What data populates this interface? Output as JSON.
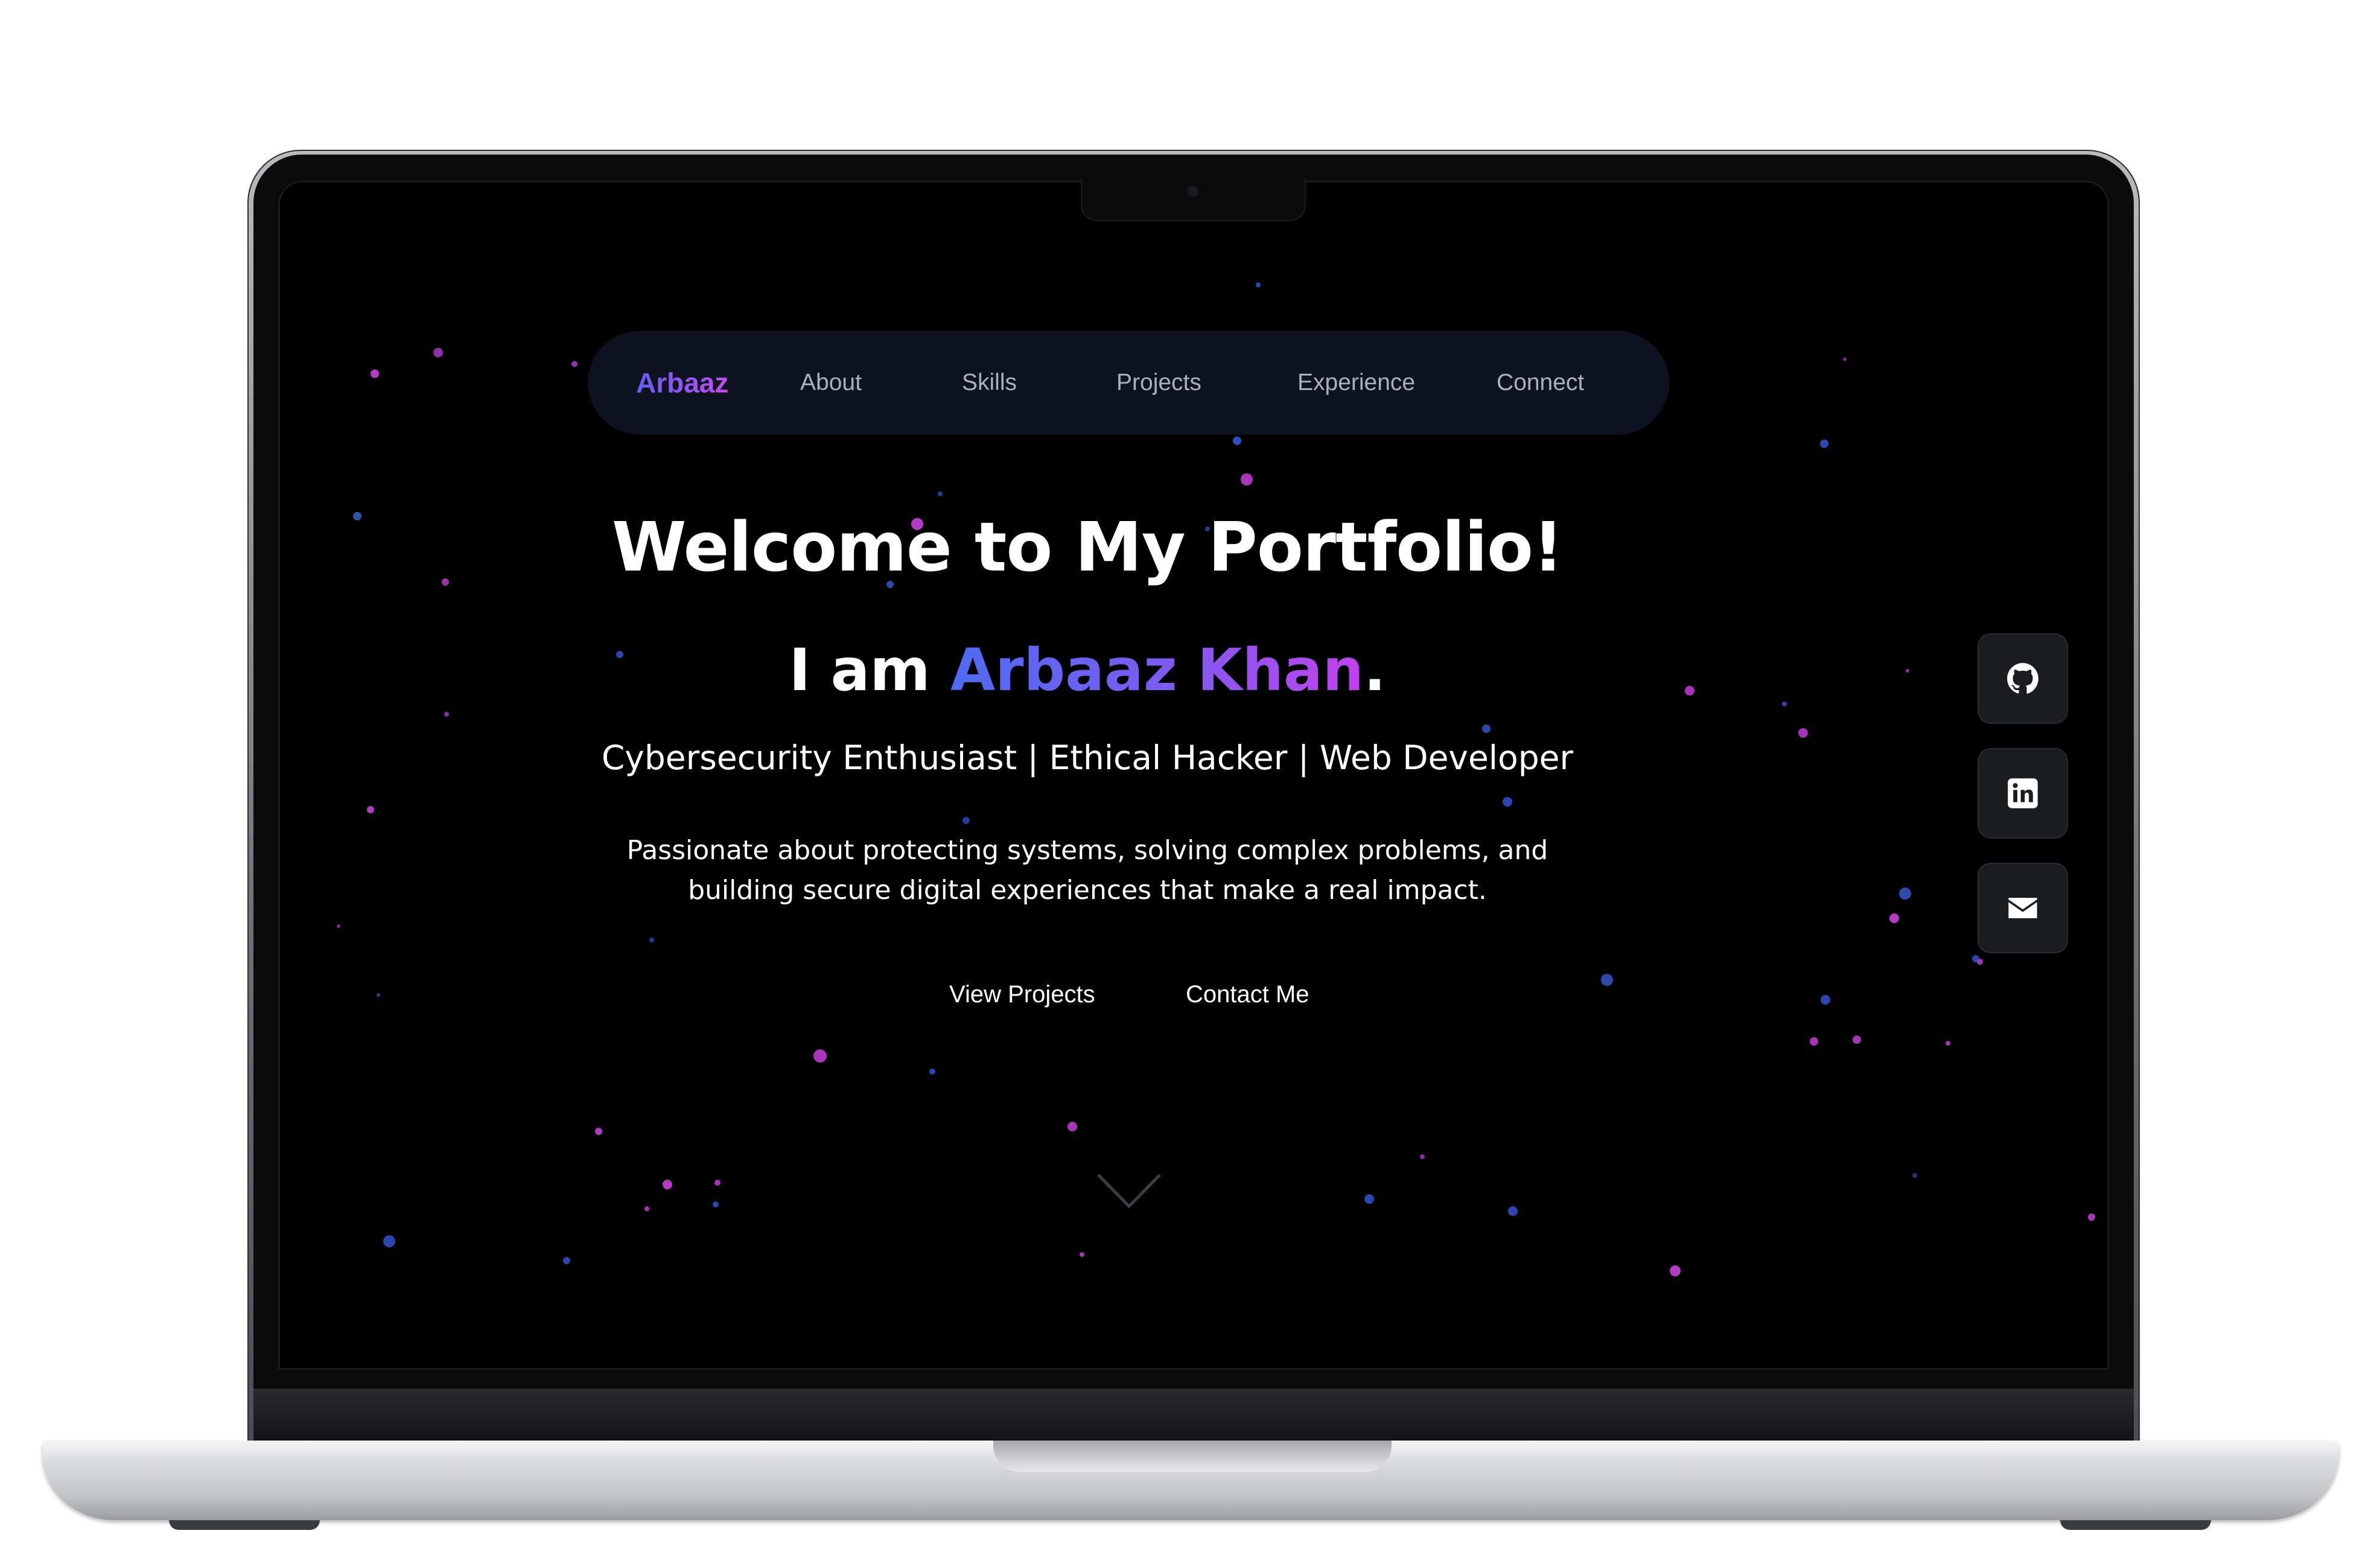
{
  "navbar": {
    "brand": "Arbaaz",
    "links": [
      "About",
      "Skills",
      "Projects",
      "Experience",
      "Connect"
    ]
  },
  "hero": {
    "title": "Welcome to My Portfolio!",
    "intro_prefix": "I am ",
    "name": "Arbaaz Khan",
    "intro_suffix": ".",
    "roles": "Cybersecurity Enthusiast | Ethical Hacker | Web Developer",
    "description": "Passionate about protecting systems, solving complex problems, and building secure digital experiences that make a real impact.",
    "buttons": {
      "projects": "View Projects",
      "contact": "Contact Me"
    }
  },
  "social": [
    {
      "name": "github",
      "icon": "github-icon"
    },
    {
      "name": "linkedin",
      "icon": "linkedin-icon"
    },
    {
      "name": "email",
      "icon": "mail-icon"
    }
  ],
  "colors": {
    "background": "#000000",
    "navbar_bg": "#0d1120",
    "nav_link": "#aab0bd",
    "gradient_start": "#4f6bf2",
    "gradient_end": "#c142ec",
    "social_bg": "#1b1c20"
  }
}
